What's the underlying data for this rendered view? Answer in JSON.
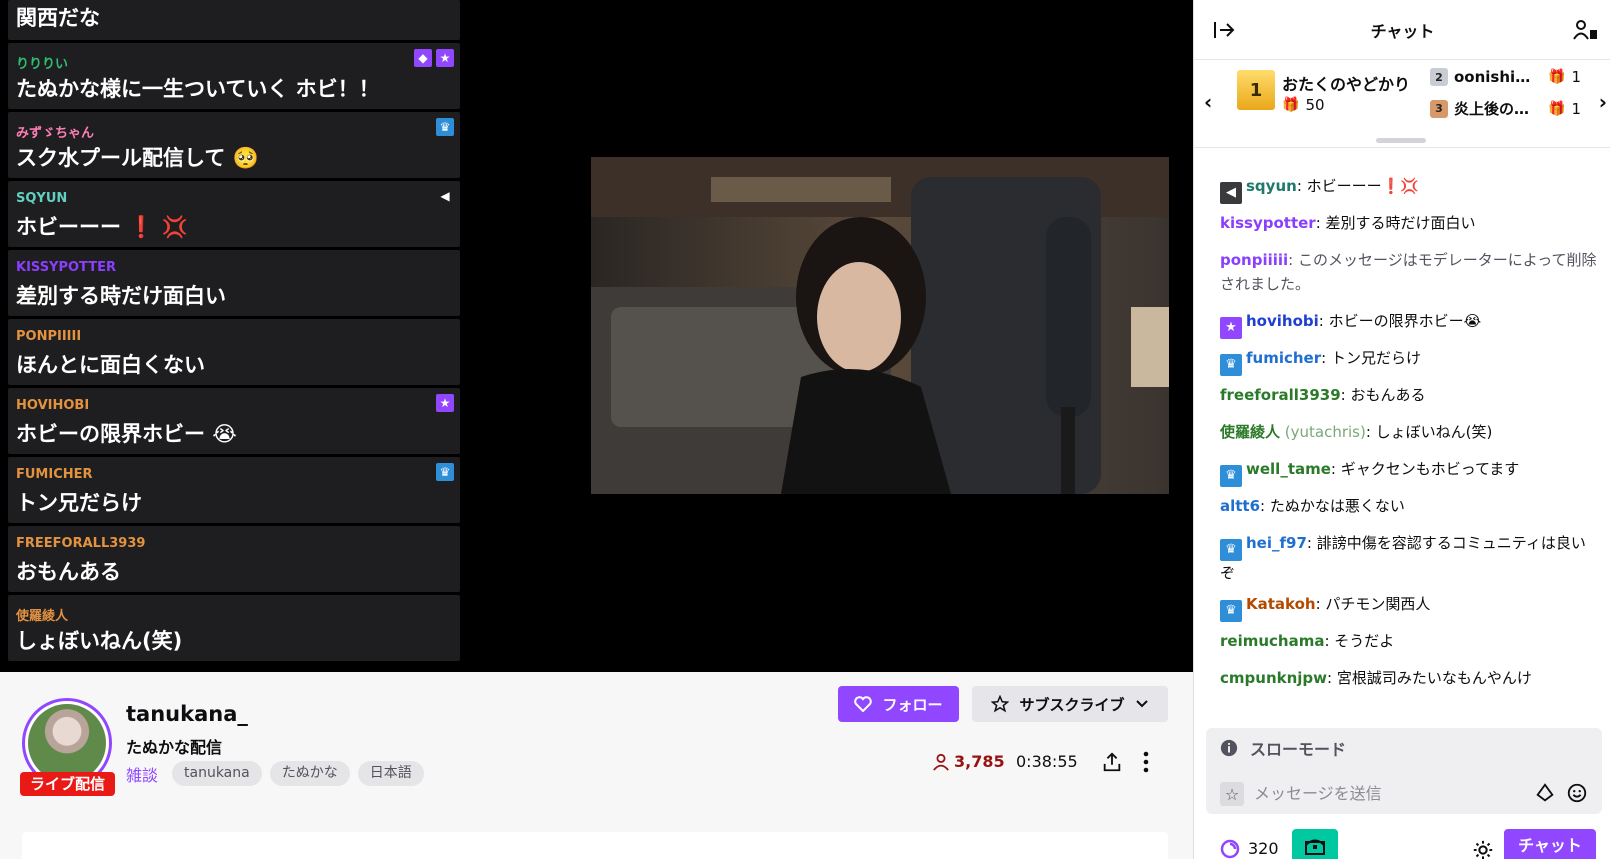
{
  "overlay": {
    "items": [
      {
        "name": "",
        "message": "関西だな",
        "name_color": "#ffffff"
      },
      {
        "name": "りりりい",
        "message": "たぬかな様に一生ついていく ホビ！！",
        "name_color": "#2fbf71",
        "badges": [
          "dark-diamond",
          "star"
        ]
      },
      {
        "name": "みずゞちゃん",
        "message": "スク水プール配信して 🥺",
        "name_color": "#ff7eb6",
        "badges": [
          "crown"
        ]
      },
      {
        "name": "SQYUN",
        "message": "ホビーーー ❗ 💢",
        "name_color": "#62d0c0",
        "badges": [
          "speaker"
        ]
      },
      {
        "name": "KISSYPOTTER",
        "message": "差別する時だけ面白い",
        "name_color": "#8a3ffc"
      },
      {
        "name": "PONPIIIII",
        "message": "ほんとに面白くない",
        "name_color": "#e39240"
      },
      {
        "name": "HOVIHOBI",
        "message": "ホビーの限界ホビー 😭",
        "name_color": "#e39240",
        "badges": [
          "star"
        ]
      },
      {
        "name": "FUMICHER",
        "message": "トン兄だらけ",
        "name_color": "#e39240",
        "badges": [
          "crown"
        ]
      },
      {
        "name": "FREEFORALL3939",
        "message": "おもんある",
        "name_color": "#e39240"
      },
      {
        "name": "使羅綾人",
        "message": "しょぼいねん(笑)",
        "name_color": "#e39240"
      }
    ]
  },
  "channel": {
    "name": "tanukana_",
    "title": "たぬかな配信",
    "category": "雑談",
    "tags": [
      "tanukana",
      "たぬかな",
      "日本語"
    ],
    "live_label": "ライブ配信",
    "viewers": "3,785",
    "uptime": "0:38:55",
    "follow_label": "フォロー",
    "subscribe_label": "サブスクライブ"
  },
  "chat": {
    "title": "チャット",
    "leaderboard": {
      "first": {
        "rank": "1",
        "name": "おたくのやどかり",
        "gifts": "50"
      },
      "second": {
        "rank": "2",
        "name": "oonishitaka",
        "gifts": "1"
      },
      "third": {
        "rank": "3",
        "name": "炎上後の焼け野原",
        "gifts": "1"
      }
    },
    "messages": [
      {
        "user": "sqyun",
        "color": "#1f7a6c",
        "text": ": ホビーーー❗💢",
        "badge": "speaker"
      },
      {
        "user": "kissypotter",
        "color": "#8a3ffc",
        "text": ": 差別する時だけ面白い"
      },
      {
        "user": "ponpiiiii",
        "color": "#8a3ffc",
        "text": ": このメッセージはモデレーターによって削除されました。",
        "deleted": true
      },
      {
        "user": "hovihobi",
        "color": "#1f3fd0",
        "text": ": ホビーの限界ホビー😭",
        "badge": "star"
      },
      {
        "user": "fumicher",
        "color": "#1f6fd0",
        "text": ": トン兄だらけ",
        "badge": "crown"
      },
      {
        "user": "freeforall3939",
        "color": "#2a7a2a",
        "text": ": おもんある"
      },
      {
        "user": "使羅綾人",
        "extra": " (yutachris)",
        "color": "#2a7a2a",
        "text": ": しょぼいねん(笑)"
      },
      {
        "user": "well_tame",
        "color": "#2a7a2a",
        "text": ": ギャクセンもホビってます",
        "badge": "crown"
      },
      {
        "user": "altt6",
        "color": "#1f6fd0",
        "text": ": たぬかなは悪くない"
      },
      {
        "user": "hei_f97",
        "color": "#1f6fd0",
        "text": ": 誹謗中傷を容認するコミュニティは良いぞ",
        "badge": "crown"
      },
      {
        "user": "Katakoh",
        "color": "#b34a00",
        "text": ": パチモン関西人",
        "badge": "crown"
      },
      {
        "user": "reimuchama",
        "color": "#2a7a2a",
        "text": ": そうだよ"
      },
      {
        "user": "cmpunknjpw",
        "color": "#2a7a2a",
        "text": ": 宮根誠司みたいなもんやんけ"
      }
    ],
    "slow_mode": "スローモード",
    "input_placeholder": "メッセージを送信",
    "points": "320",
    "send_label": "チャット"
  },
  "colors": {
    "accent": "#9147ff",
    "live": "#e91916"
  }
}
